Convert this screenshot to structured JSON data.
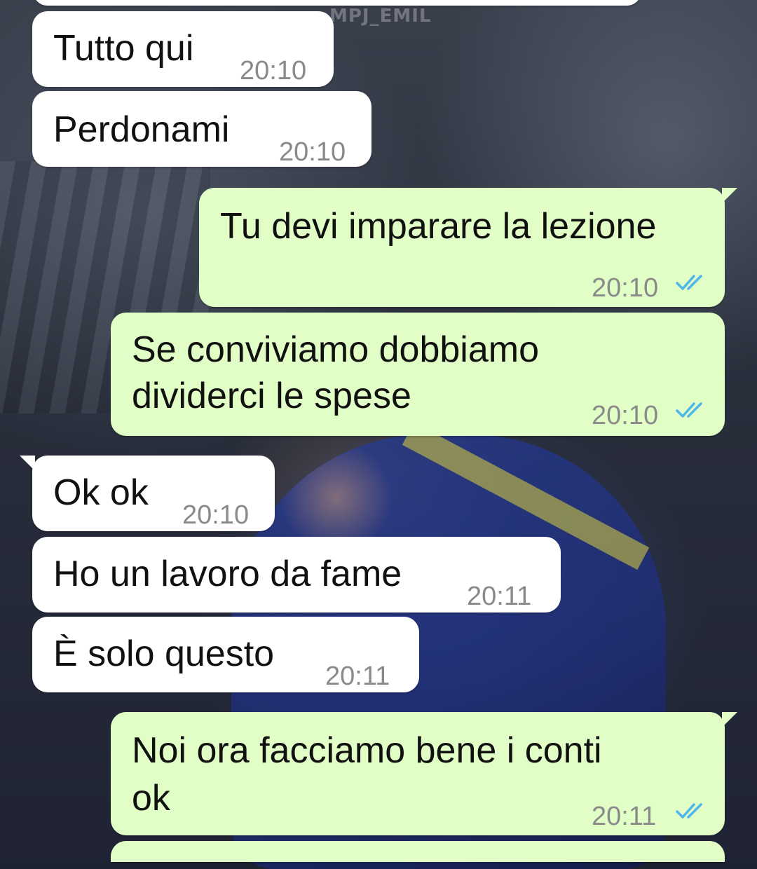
{
  "wallpaper": {
    "watermark": "MPJ_EMIL"
  },
  "messages": [
    {
      "text": "Tutto qui",
      "time": "20:10"
    },
    {
      "text": "Perdonami",
      "time": "20:10"
    },
    {
      "text": "Tu devi imparare la lezione",
      "time": "20:10",
      "status": "read"
    },
    {
      "text_line1": "Se conviviamo dobbiamo",
      "text_line2": "dividerci le spese",
      "time": "20:10",
      "status": "read"
    },
    {
      "text": "Ok ok",
      "time": "20:10"
    },
    {
      "text": "Ho un lavoro da fame",
      "time": "20:11"
    },
    {
      "text": "È solo questo",
      "time": "20:11"
    },
    {
      "text_line1": "Noi ora facciamo bene i conti",
      "text_line2": "ok",
      "time": "20:11",
      "status": "read"
    }
  ],
  "colors": {
    "incoming_bubble": "#ffffff",
    "outgoing_bubble": "#e1fec6",
    "read_ticks": "#4fb6ec",
    "timestamp": "#8a8a8a"
  }
}
